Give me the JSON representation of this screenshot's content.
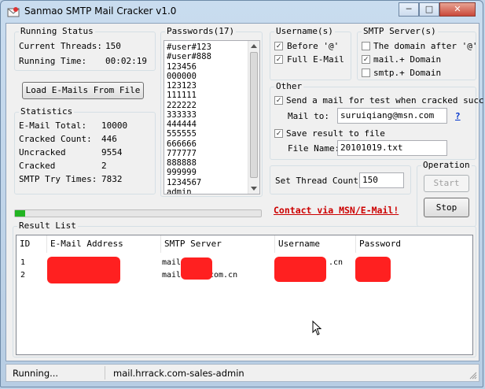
{
  "window": {
    "title": "Sanmao SMTP Mail Cracker v1.0",
    "minimize": "─",
    "maximize": "□",
    "close": "✕"
  },
  "running_status": {
    "label": "Running Status",
    "threads_label": "Current Threads:",
    "threads_value": "150",
    "time_label": "Running Time:",
    "time_value": "00:02:19"
  },
  "load_button": "Load E-Mails From File",
  "statistics": {
    "label": "Statistics",
    "rows": [
      {
        "label": "E-Mail Total:",
        "value": "10000"
      },
      {
        "label": "Cracked Count:",
        "value": "446"
      },
      {
        "label": "Uncracked",
        "value": "9554"
      },
      {
        "label": "Cracked",
        "value": "2"
      },
      {
        "label": "SMTP Try Times:",
        "value": "7832"
      }
    ]
  },
  "passwords": {
    "label": "Passwords(17)",
    "items": [
      "#user#123",
      "#user#888",
      "123456",
      "000000",
      "123123",
      "111111",
      "222222",
      "333333",
      "444444",
      "555555",
      "666666",
      "777777",
      "888888",
      "999999",
      "1234567",
      "admin"
    ]
  },
  "username": {
    "label": "Username(s)",
    "options": [
      {
        "label": "Before '@'",
        "checked": true
      },
      {
        "label": "Full E-Mail",
        "checked": true
      }
    ]
  },
  "smtp_server": {
    "label": "SMTP Server(s)",
    "options": [
      {
        "label": "The domain after '@'",
        "checked": false
      },
      {
        "label": "mail.+ Domain",
        "checked": true
      },
      {
        "label": "smtp.+ Domain",
        "checked": false
      }
    ]
  },
  "other": {
    "label": "Other",
    "send_mail_label": "Send a mail for test when cracked succ",
    "send_mail_checked": true,
    "mail_to_label": "Mail to:",
    "mail_to_value": "suruiqiang@msn.com",
    "help": "?",
    "save_result_label": "Save result to file",
    "save_result_checked": true,
    "file_name_label": "File Name:",
    "file_name_value": "20101019.txt"
  },
  "thread": {
    "label": "Set Thread Count:",
    "value": "150"
  },
  "operation": {
    "label": "Operation",
    "start": "Start",
    "stop": "Stop"
  },
  "contact_link": "Contact via MSN/E-Mail!",
  "progress": {
    "fraction": 0.04
  },
  "result": {
    "label": "Result List",
    "columns": [
      "ID",
      "E-Mail Address",
      "SMTP Server",
      "Username",
      "Password"
    ],
    "rows": [
      {
        "id": "1",
        "smtp_prefix": "mail.",
        "smtp_suffix": "",
        "username_suffix": ".cn"
      },
      {
        "id": "2",
        "smtp_prefix": "mail",
        "smtp_suffix": "com.cn",
        "username_suffix": ""
      }
    ]
  },
  "statusbar": {
    "left": "Running...",
    "right": "mail.hrrack.com-sales-admin"
  },
  "colors": {
    "link": "#cc0000",
    "redaction": "#ff2020",
    "progress": "#22b422"
  }
}
